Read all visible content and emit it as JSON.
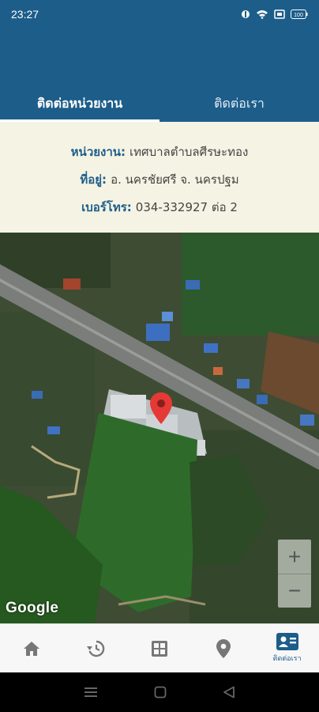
{
  "status_bar": {
    "time": "23:27",
    "battery": "100"
  },
  "tabs": [
    {
      "label": "ติดต่อหน่วยงาน",
      "active": true
    },
    {
      "label": "ติดต่อเรา",
      "active": false
    }
  ],
  "info": {
    "agency_label": "หน่วยงาน:",
    "agency_value": "เทศบาลตำบลศีรษะทอง",
    "address_label": "ที่อยู่:",
    "address_value": "อ. นครชัยศรี จ. นครปฐม",
    "phone_label": "เบอร์โทร:",
    "phone_value": "034-332927 ต่อ 2"
  },
  "map": {
    "attribution": "Google",
    "zoom_in": "+",
    "zoom_out": "−"
  },
  "bottom_nav": {
    "items": [
      {
        "icon": "home-icon"
      },
      {
        "icon": "history-icon"
      },
      {
        "icon": "grid-icon"
      },
      {
        "icon": "location-pin-icon"
      },
      {
        "icon": "contact-card-icon",
        "label": "ติดต่อเรา",
        "active": true
      }
    ]
  },
  "colors": {
    "primary": "#1d5d8a",
    "panel_bg": "#f5f3e3",
    "pin": "#e53935"
  }
}
